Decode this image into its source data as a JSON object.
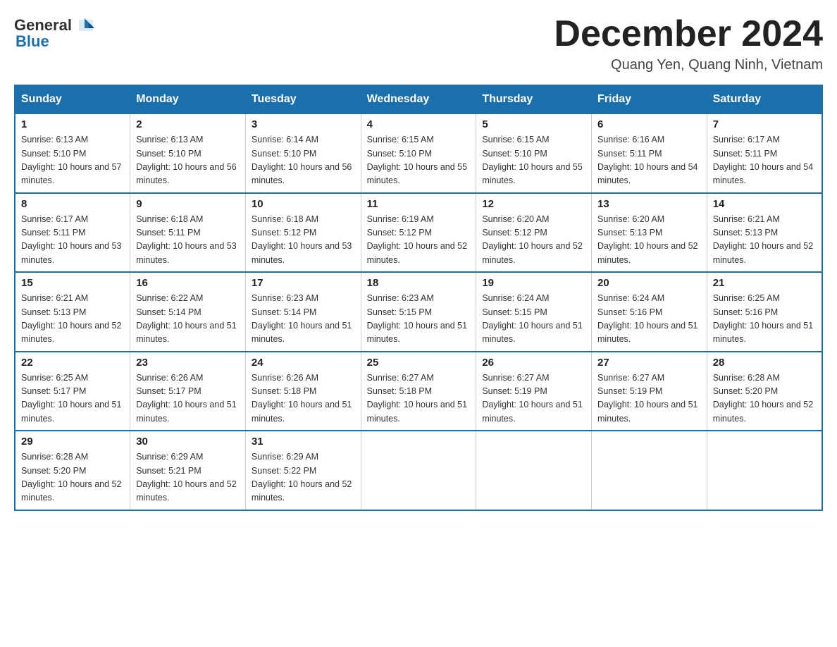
{
  "header": {
    "logo_general": "General",
    "logo_blue": "Blue",
    "month_title": "December 2024",
    "location": "Quang Yen, Quang Ninh, Vietnam"
  },
  "weekdays": [
    "Sunday",
    "Monday",
    "Tuesday",
    "Wednesday",
    "Thursday",
    "Friday",
    "Saturday"
  ],
  "weeks": [
    [
      {
        "day": "1",
        "sunrise": "6:13 AM",
        "sunset": "5:10 PM",
        "daylight": "10 hours and 57 minutes."
      },
      {
        "day": "2",
        "sunrise": "6:13 AM",
        "sunset": "5:10 PM",
        "daylight": "10 hours and 56 minutes."
      },
      {
        "day": "3",
        "sunrise": "6:14 AM",
        "sunset": "5:10 PM",
        "daylight": "10 hours and 56 minutes."
      },
      {
        "day": "4",
        "sunrise": "6:15 AM",
        "sunset": "5:10 PM",
        "daylight": "10 hours and 55 minutes."
      },
      {
        "day": "5",
        "sunrise": "6:15 AM",
        "sunset": "5:10 PM",
        "daylight": "10 hours and 55 minutes."
      },
      {
        "day": "6",
        "sunrise": "6:16 AM",
        "sunset": "5:11 PM",
        "daylight": "10 hours and 54 minutes."
      },
      {
        "day": "7",
        "sunrise": "6:17 AM",
        "sunset": "5:11 PM",
        "daylight": "10 hours and 54 minutes."
      }
    ],
    [
      {
        "day": "8",
        "sunrise": "6:17 AM",
        "sunset": "5:11 PM",
        "daylight": "10 hours and 53 minutes."
      },
      {
        "day": "9",
        "sunrise": "6:18 AM",
        "sunset": "5:11 PM",
        "daylight": "10 hours and 53 minutes."
      },
      {
        "day": "10",
        "sunrise": "6:18 AM",
        "sunset": "5:12 PM",
        "daylight": "10 hours and 53 minutes."
      },
      {
        "day": "11",
        "sunrise": "6:19 AM",
        "sunset": "5:12 PM",
        "daylight": "10 hours and 52 minutes."
      },
      {
        "day": "12",
        "sunrise": "6:20 AM",
        "sunset": "5:12 PM",
        "daylight": "10 hours and 52 minutes."
      },
      {
        "day": "13",
        "sunrise": "6:20 AM",
        "sunset": "5:13 PM",
        "daylight": "10 hours and 52 minutes."
      },
      {
        "day": "14",
        "sunrise": "6:21 AM",
        "sunset": "5:13 PM",
        "daylight": "10 hours and 52 minutes."
      }
    ],
    [
      {
        "day": "15",
        "sunrise": "6:21 AM",
        "sunset": "5:13 PM",
        "daylight": "10 hours and 52 minutes."
      },
      {
        "day": "16",
        "sunrise": "6:22 AM",
        "sunset": "5:14 PM",
        "daylight": "10 hours and 51 minutes."
      },
      {
        "day": "17",
        "sunrise": "6:23 AM",
        "sunset": "5:14 PM",
        "daylight": "10 hours and 51 minutes."
      },
      {
        "day": "18",
        "sunrise": "6:23 AM",
        "sunset": "5:15 PM",
        "daylight": "10 hours and 51 minutes."
      },
      {
        "day": "19",
        "sunrise": "6:24 AM",
        "sunset": "5:15 PM",
        "daylight": "10 hours and 51 minutes."
      },
      {
        "day": "20",
        "sunrise": "6:24 AM",
        "sunset": "5:16 PM",
        "daylight": "10 hours and 51 minutes."
      },
      {
        "day": "21",
        "sunrise": "6:25 AM",
        "sunset": "5:16 PM",
        "daylight": "10 hours and 51 minutes."
      }
    ],
    [
      {
        "day": "22",
        "sunrise": "6:25 AM",
        "sunset": "5:17 PM",
        "daylight": "10 hours and 51 minutes."
      },
      {
        "day": "23",
        "sunrise": "6:26 AM",
        "sunset": "5:17 PM",
        "daylight": "10 hours and 51 minutes."
      },
      {
        "day": "24",
        "sunrise": "6:26 AM",
        "sunset": "5:18 PM",
        "daylight": "10 hours and 51 minutes."
      },
      {
        "day": "25",
        "sunrise": "6:27 AM",
        "sunset": "5:18 PM",
        "daylight": "10 hours and 51 minutes."
      },
      {
        "day": "26",
        "sunrise": "6:27 AM",
        "sunset": "5:19 PM",
        "daylight": "10 hours and 51 minutes."
      },
      {
        "day": "27",
        "sunrise": "6:27 AM",
        "sunset": "5:19 PM",
        "daylight": "10 hours and 51 minutes."
      },
      {
        "day": "28",
        "sunrise": "6:28 AM",
        "sunset": "5:20 PM",
        "daylight": "10 hours and 52 minutes."
      }
    ],
    [
      {
        "day": "29",
        "sunrise": "6:28 AM",
        "sunset": "5:20 PM",
        "daylight": "10 hours and 52 minutes."
      },
      {
        "day": "30",
        "sunrise": "6:29 AM",
        "sunset": "5:21 PM",
        "daylight": "10 hours and 52 minutes."
      },
      {
        "day": "31",
        "sunrise": "6:29 AM",
        "sunset": "5:22 PM",
        "daylight": "10 hours and 52 minutes."
      },
      null,
      null,
      null,
      null
    ]
  ]
}
